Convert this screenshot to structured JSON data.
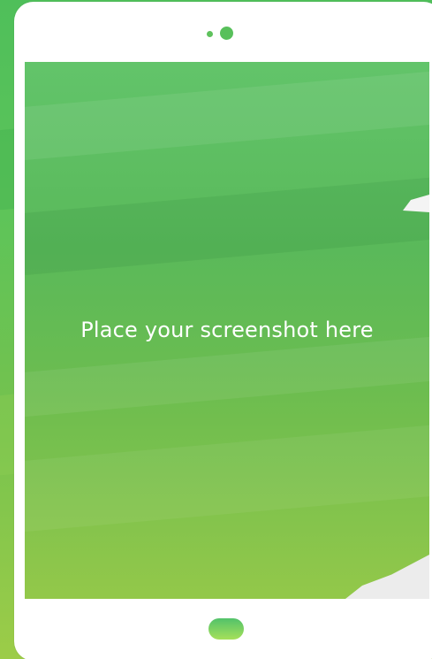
{
  "placeholder": {
    "text": "Place your screenshot here"
  },
  "device": {
    "camera_icon": "camera-lens-icon",
    "sensor_icon": "sensor-dot-icon",
    "home_button_icon": "home-button-icon"
  },
  "colors": {
    "background_green": "#5cc45a",
    "accent_green": "#58c05b",
    "home_button_top": "#52c26a",
    "home_button_bottom": "#a6e05a",
    "device_frame": "#ffffff",
    "text": "#ffffff"
  }
}
